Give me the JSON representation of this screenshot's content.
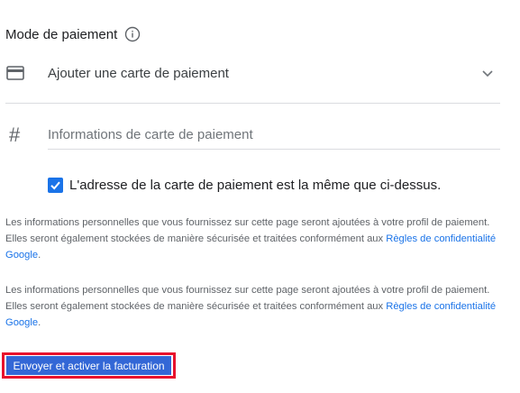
{
  "section": {
    "title": "Mode de paiement"
  },
  "payment_method": {
    "label": "Ajouter une carte de paiement"
  },
  "card_number": {
    "placeholder": "Informations de carte de paiement",
    "value": ""
  },
  "same_address": {
    "checked": true,
    "label": "L'adresse de la carte de paiement est la même que ci-dessus."
  },
  "notices": [
    {
      "text": "Les informations personnelles que vous fournissez sur cette page seront ajoutées à votre profil de paiement. Elles seront également stockées de manière sécurisée et traitées conformément aux ",
      "link_text": "Règles de confidentialité Google",
      "suffix": "."
    },
    {
      "text": "Les informations personnelles que vous fournissez sur cette page seront ajoutées à votre profil de paiement. Elles seront également stockées de manière sécurisée et traitées conformément aux ",
      "link_text": "Règles de confidentialité Google",
      "suffix": "."
    }
  ],
  "submit": {
    "label": "Envoyer et activer la facturation"
  },
  "icons": {
    "info": "info-icon",
    "card": "credit-card-icon",
    "chevron": "chevron-down-icon",
    "hash": "hash-icon",
    "checkbox": "checkmark-icon"
  },
  "colors": {
    "accent": "#1a73e8",
    "button": "#3367d6",
    "highlight_border": "#e8112d",
    "divider": "#dadce0"
  }
}
